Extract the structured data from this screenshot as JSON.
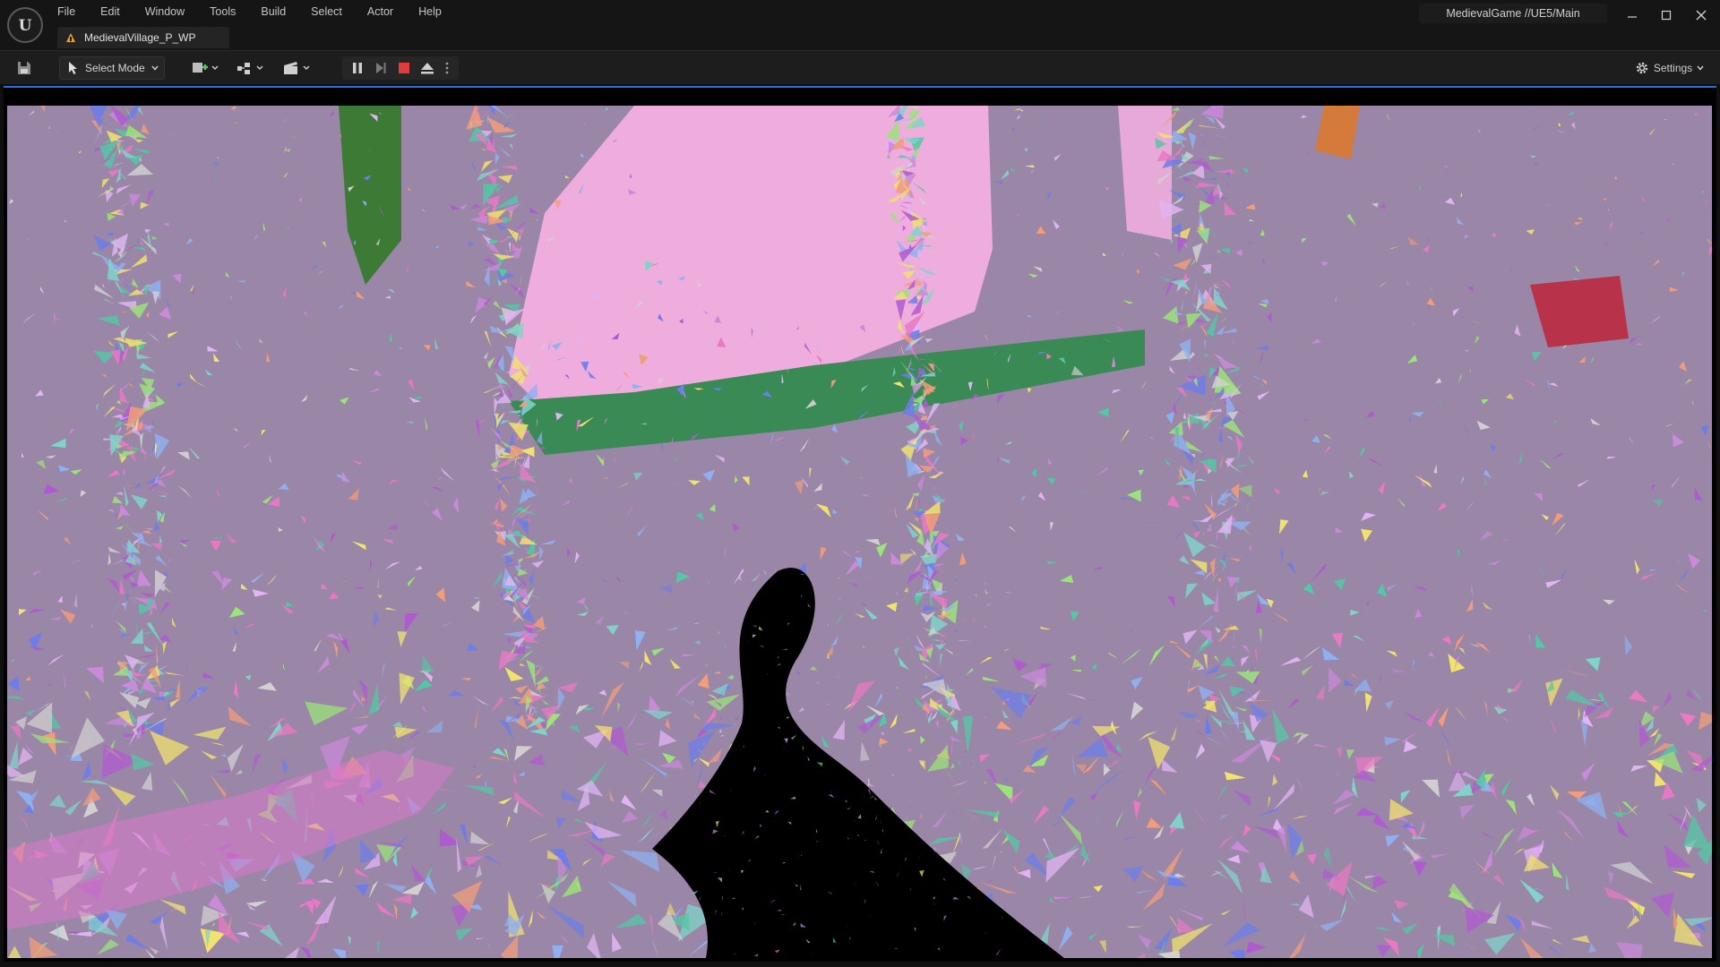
{
  "window": {
    "project_label": "MedievalGame //UE5/Main",
    "level_tab": "MedievalVillage_P_WP"
  },
  "menu": [
    "File",
    "Edit",
    "Window",
    "Tools",
    "Build",
    "Select",
    "Actor",
    "Help"
  ],
  "toolbar": {
    "mode_label": "Select Mode",
    "settings_label": "Settings"
  },
  "viewport": {
    "view_mode": "Nanite Triangles",
    "sky_color": "#efaddd",
    "river_color": "#000000",
    "palette": [
      "#c98ad8",
      "#7fd3c9",
      "#e879c3",
      "#8fb0f0",
      "#9be37a",
      "#f0e26d",
      "#6e7de8",
      "#f29c7a",
      "#d0d0d0",
      "#54c7a3",
      "#b05ad0",
      "#e0b4f2"
    ]
  },
  "colors": {
    "titlebar_bg": "#151515",
    "toolbar_bg": "#1d1d1d",
    "stop_red": "#e13b3b",
    "accent_blue": "#2d6cdf"
  }
}
